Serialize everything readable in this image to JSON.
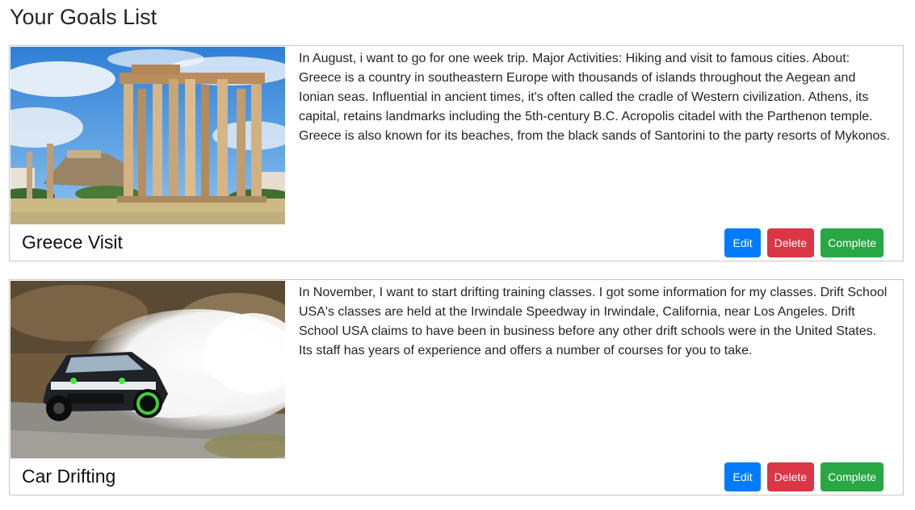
{
  "page": {
    "title": "Your Goals List"
  },
  "goals": [
    {
      "title": "Greece Visit",
      "description": "In August, i want to go for one week trip. Major Activities: Hiking and visit to famous cities. About: Greece is a country in southeastern Europe with thousands of islands throughout the Aegean and Ionian seas. Influential in ancient times, it's often called the cradle of Western civilization. Athens, its capital, retains landmarks including the 5th-century B.C. Acropolis citadel with the Parthenon temple. Greece is also known for its beaches, from the black sands of Santorini to the party resorts of Mykonos.",
      "image": "temple-of-olympian-zeus-photo"
    },
    {
      "title": "Car Drifting",
      "description": "In November, I want to start drifting training classes. I got some information for my classes. Drift School USA's classes are held at the Irwindale Speedway in Irwindale, California, near Los Angeles. Drift School USA claims to have been in business before any other drift schools were in the United States. Its staff has years of experience and offers a number of courses for you to take.",
      "image": "drifting-car-photo"
    }
  ],
  "buttons": {
    "edit": "Edit",
    "delete": "Delete",
    "complete": "Complete"
  },
  "colors": {
    "edit": "#007bff",
    "delete": "#dc3545",
    "complete": "#28a745",
    "card_border": "#c8c8c8"
  }
}
